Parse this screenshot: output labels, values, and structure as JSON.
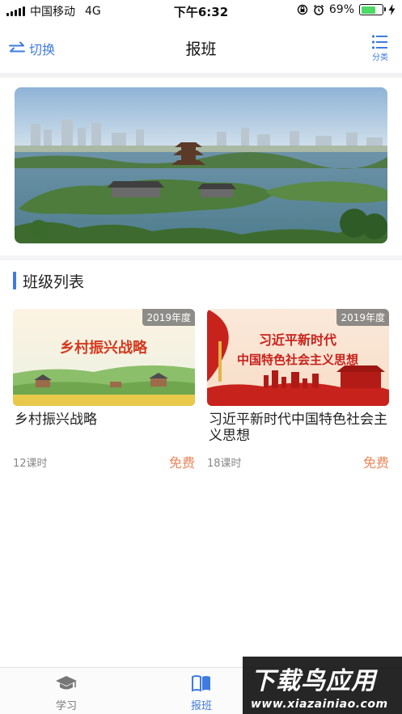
{
  "status_bar": {
    "carrier": "中国移动",
    "network": "4G",
    "time": "下午6:32",
    "battery": "69%",
    "battery_level": 0.69,
    "icons": [
      "signal-icon",
      "orientation-lock-icon",
      "alarm-icon",
      "battery-icon",
      "charging-icon"
    ]
  },
  "nav": {
    "switch_label": "切换",
    "title": "报班",
    "category_label": "分类",
    "accent_color": "#3f7be0"
  },
  "section": {
    "title": "班级列表"
  },
  "courses": [
    {
      "image_text": "乡村振兴战略",
      "year": "2019年度",
      "title": "乡村振兴战略",
      "hours": "12课时",
      "price": "免费"
    },
    {
      "image_line1": "习近平新时代",
      "image_line2": "中国特色社会主义思想",
      "year": "2019年度",
      "title": "习近平新时代中国特色社会主义思想",
      "hours": "18课时",
      "price": "免费"
    }
  ],
  "tabs": [
    {
      "label": "学习",
      "icon": "graduation-cap-icon",
      "active": false
    },
    {
      "label": "报班",
      "icon": "book-icon",
      "active": true
    }
  ],
  "watermark": {
    "main": "下载鸟应用",
    "sub": "www.xiazainiao.com"
  }
}
